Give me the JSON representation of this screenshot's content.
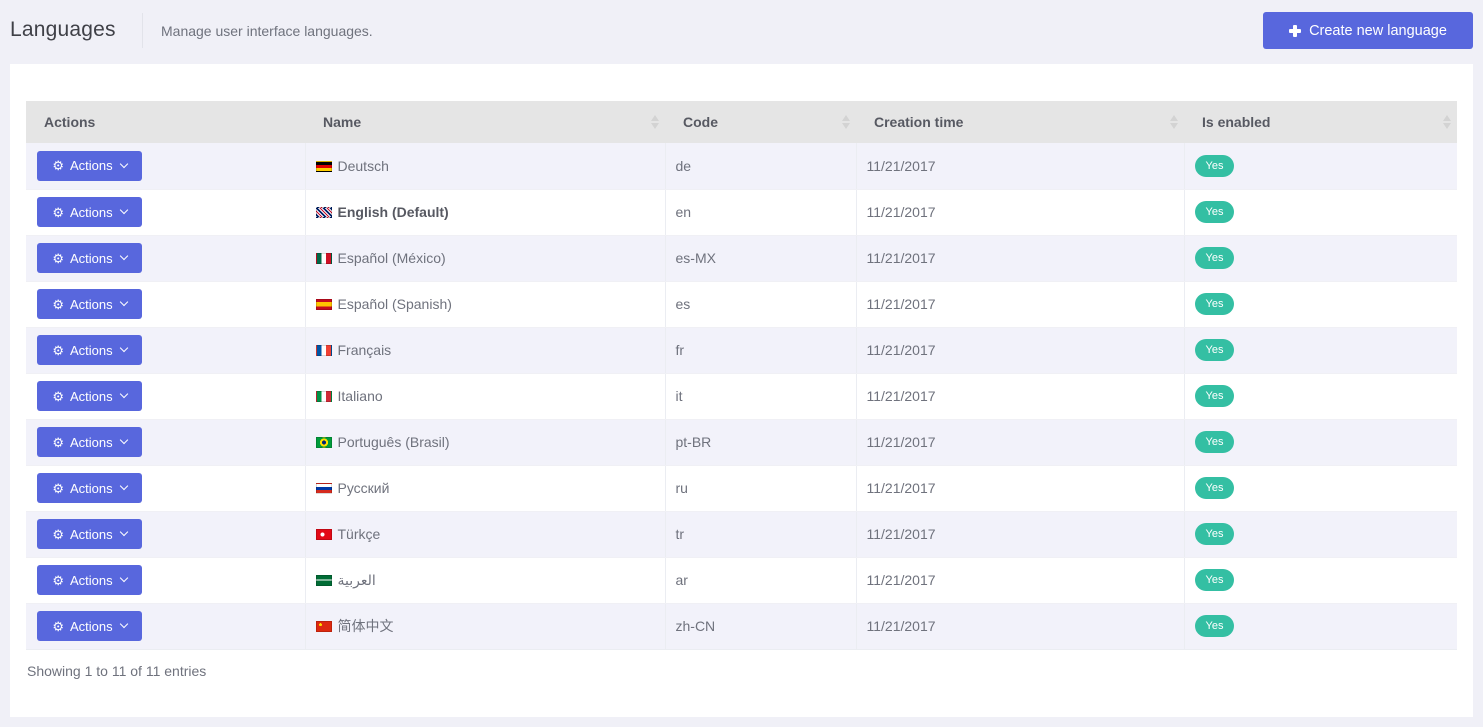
{
  "header": {
    "title": "Languages",
    "description": "Manage user interface languages.",
    "create_button_label": "Create new language"
  },
  "table": {
    "columns": [
      {
        "label": "Actions",
        "sortable": false
      },
      {
        "label": "Name",
        "sortable": true
      },
      {
        "label": "Code",
        "sortable": true
      },
      {
        "label": "Creation time",
        "sortable": true
      },
      {
        "label": "Is enabled",
        "sortable": true
      }
    ],
    "action_button_label": "Actions",
    "rows": [
      {
        "flag": "de",
        "name": "Deutsch",
        "is_default": false,
        "code": "de",
        "creation_time": "11/21/2017",
        "is_enabled": "Yes"
      },
      {
        "flag": "gb",
        "name": "English (Default)",
        "is_default": true,
        "code": "en",
        "creation_time": "11/21/2017",
        "is_enabled": "Yes"
      },
      {
        "flag": "mx",
        "name": "Español (México)",
        "is_default": false,
        "code": "es-MX",
        "creation_time": "11/21/2017",
        "is_enabled": "Yes"
      },
      {
        "flag": "es",
        "name": "Español (Spanish)",
        "is_default": false,
        "code": "es",
        "creation_time": "11/21/2017",
        "is_enabled": "Yes"
      },
      {
        "flag": "fr",
        "name": "Français",
        "is_default": false,
        "code": "fr",
        "creation_time": "11/21/2017",
        "is_enabled": "Yes"
      },
      {
        "flag": "it",
        "name": "Italiano",
        "is_default": false,
        "code": "it",
        "creation_time": "11/21/2017",
        "is_enabled": "Yes"
      },
      {
        "flag": "br",
        "name": "Português (Brasil)",
        "is_default": false,
        "code": "pt-BR",
        "creation_time": "11/21/2017",
        "is_enabled": "Yes"
      },
      {
        "flag": "ru",
        "name": "Русский",
        "is_default": false,
        "code": "ru",
        "creation_time": "11/21/2017",
        "is_enabled": "Yes"
      },
      {
        "flag": "tr",
        "name": "Türkçe",
        "is_default": false,
        "code": "tr",
        "creation_time": "11/21/2017",
        "is_enabled": "Yes"
      },
      {
        "flag": "sa",
        "name": "العربية",
        "is_default": false,
        "code": "ar",
        "creation_time": "11/21/2017",
        "is_enabled": "Yes"
      },
      {
        "flag": "cn",
        "name": "简体中文",
        "is_default": false,
        "code": "zh-CN",
        "creation_time": "11/21/2017",
        "is_enabled": "Yes"
      }
    ]
  },
  "footer": {
    "info": "Showing 1 to 11 of 11 entries"
  },
  "colors": {
    "primary": "#5867dd",
    "success": "#34bfa3",
    "header_bg": "#e5e5e5",
    "row_stripe": "#f2f2fa",
    "page_bg": "#f0f0f7"
  }
}
